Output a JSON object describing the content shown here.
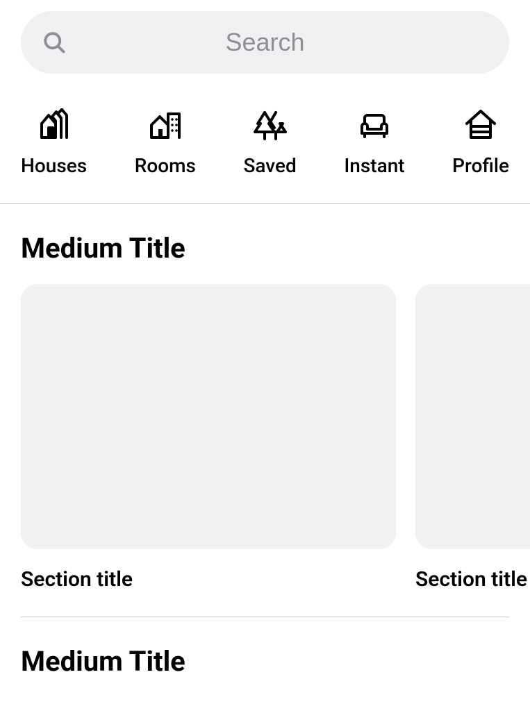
{
  "search": {
    "placeholder": "Search",
    "value": ""
  },
  "tabs": [
    {
      "id": "houses",
      "label": "Houses",
      "icon": "houses-icon"
    },
    {
      "id": "rooms",
      "label": "Rooms",
      "icon": "rooms-icon"
    },
    {
      "id": "saved",
      "label": "Saved",
      "icon": "trees-icon"
    },
    {
      "id": "instant",
      "label": "Instant",
      "icon": "couch-icon"
    },
    {
      "id": "profile",
      "label": "Profile",
      "icon": "house-roof-icon"
    }
  ],
  "sections": [
    {
      "heading": "Medium Title",
      "cards": [
        {
          "title": "Section title"
        },
        {
          "title": "Section title"
        }
      ]
    },
    {
      "heading": "Medium Title",
      "cards": []
    }
  ]
}
